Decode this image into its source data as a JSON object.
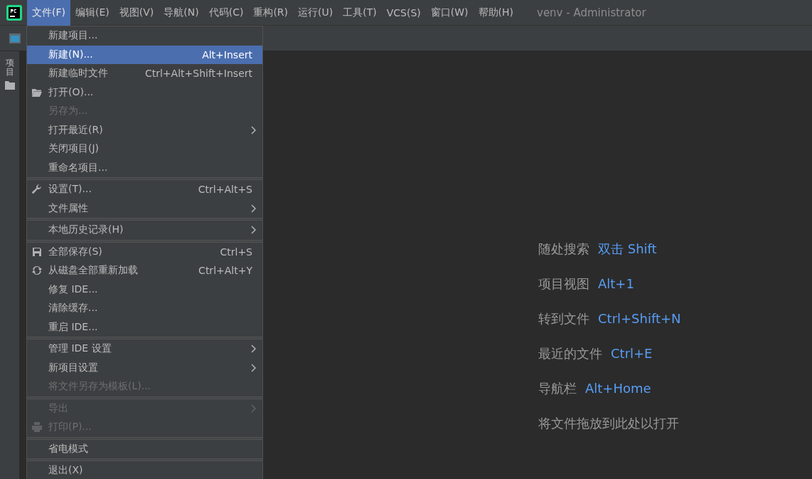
{
  "menu_bar": {
    "items": [
      {
        "label": "文件(F)",
        "selected": true
      },
      {
        "label": "编辑(E)",
        "selected": false
      },
      {
        "label": "视图(V)",
        "selected": false
      },
      {
        "label": "导航(N)",
        "selected": false
      },
      {
        "label": "代码(C)",
        "selected": false
      },
      {
        "label": "重构(R)",
        "selected": false
      },
      {
        "label": "运行(U)",
        "selected": false
      },
      {
        "label": "工具(T)",
        "selected": false
      },
      {
        "label": "VCS(S)",
        "selected": false
      },
      {
        "label": "窗口(W)",
        "selected": false
      },
      {
        "label": "帮助(H)",
        "selected": false
      }
    ],
    "window_title": "venv - Administrator"
  },
  "side_panel": {
    "tab": "项目"
  },
  "file_menu": [
    {
      "kind": "item",
      "label": "新建项目...",
      "selected": false,
      "disabled": false
    },
    {
      "kind": "item",
      "label": "新建(N)...",
      "shortcut": "Alt+Insert",
      "selected": true,
      "disabled": false
    },
    {
      "kind": "item",
      "label": "新建临时文件",
      "shortcut": "Ctrl+Alt+Shift+Insert",
      "selected": false,
      "disabled": false
    },
    {
      "kind": "item",
      "label": "打开(O)...",
      "selected": false,
      "disabled": false
    },
    {
      "kind": "item",
      "label": "另存为...",
      "selected": false,
      "disabled": true
    },
    {
      "kind": "item",
      "label": "打开最近(R)",
      "submenu": true,
      "selected": false,
      "disabled": false
    },
    {
      "kind": "item",
      "label": "关闭项目(J)",
      "selected": false,
      "disabled": false
    },
    {
      "kind": "item",
      "label": "重命名项目...",
      "selected": false,
      "disabled": false
    },
    {
      "kind": "separator"
    },
    {
      "kind": "item",
      "label": "设置(T)...",
      "shortcut": "Ctrl+Alt+S",
      "selected": false,
      "disabled": false
    },
    {
      "kind": "item",
      "label": "文件属性",
      "submenu": true,
      "selected": false,
      "disabled": false
    },
    {
      "kind": "separator"
    },
    {
      "kind": "item",
      "label": "本地历史记录(H)",
      "submenu": true,
      "selected": false,
      "disabled": false
    },
    {
      "kind": "separator"
    },
    {
      "kind": "item",
      "label": "全部保存(S)",
      "shortcut": "Ctrl+S",
      "selected": false,
      "disabled": false
    },
    {
      "kind": "item",
      "label": "从磁盘全部重新加载",
      "shortcut": "Ctrl+Alt+Y",
      "selected": false,
      "disabled": false
    },
    {
      "kind": "item",
      "label": "修复 IDE...",
      "selected": false,
      "disabled": false
    },
    {
      "kind": "item",
      "label": "清除缓存...",
      "selected": false,
      "disabled": false
    },
    {
      "kind": "item",
      "label": "重启 IDE...",
      "selected": false,
      "disabled": false
    },
    {
      "kind": "separator"
    },
    {
      "kind": "item",
      "label": "管理 IDE 设置",
      "submenu": true,
      "selected": false,
      "disabled": false
    },
    {
      "kind": "item",
      "label": "新项目设置",
      "submenu": true,
      "selected": false,
      "disabled": false
    },
    {
      "kind": "item",
      "label": "将文件另存为模板(L)...",
      "selected": false,
      "disabled": true
    },
    {
      "kind": "separator"
    },
    {
      "kind": "item",
      "label": "导出",
      "submenu": true,
      "selected": false,
      "disabled": true
    },
    {
      "kind": "item",
      "label": "打印(P)...",
      "selected": false,
      "disabled": true
    },
    {
      "kind": "separator"
    },
    {
      "kind": "item",
      "label": "省电模式",
      "selected": false,
      "disabled": false
    },
    {
      "kind": "separator"
    },
    {
      "kind": "item",
      "label": "退出(X)",
      "selected": false,
      "disabled": false
    }
  ],
  "welcome_hints": [
    {
      "label": "随处搜索",
      "shortcut": "双击 Shift"
    },
    {
      "label": "项目视图",
      "shortcut": "Alt+1"
    },
    {
      "label": "转到文件",
      "shortcut": "Ctrl+Shift+N"
    },
    {
      "label": "最近的文件",
      "shortcut": "Ctrl+E"
    },
    {
      "label": "导航栏",
      "shortcut": "Alt+Home"
    },
    {
      "label": "将文件拖放到此处以打开"
    }
  ]
}
